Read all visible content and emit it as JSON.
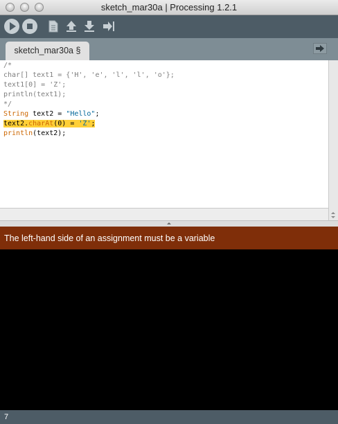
{
  "window": {
    "title": "sketch_mar30a | Processing 1.2.1"
  },
  "toolbar": {
    "buttons": [
      {
        "name": "run",
        "icon": "play-icon"
      },
      {
        "name": "stop",
        "icon": "stop-icon"
      },
      {
        "name": "new",
        "icon": "new-file-icon"
      },
      {
        "name": "open",
        "icon": "open-arrow-up-icon"
      },
      {
        "name": "save",
        "icon": "save-arrow-down-icon"
      },
      {
        "name": "export",
        "icon": "export-arrow-right-icon"
      }
    ]
  },
  "tabs": [
    {
      "label": "sketch_mar30a §"
    }
  ],
  "editor": {
    "lines": [
      "/*",
      "char[] text1 = {'H', 'e', 'l', 'l', 'o'};",
      "text1[0] = 'Z';",
      "println(text1);",
      "*/",
      "String text2 = \"Hello\";",
      "text2.charAt(0) = 'Z';",
      "println(text2);"
    ]
  },
  "status": {
    "message": "The left-hand side of an assignment must be a variable"
  },
  "footer": {
    "line_number": "7"
  },
  "colors": {
    "toolbar_bg": "#4d5c66",
    "tabbar_bg": "#7e8d95",
    "error_bg": "#7f2e09",
    "highlight": "#ffcf37",
    "keyword": "#cc6600",
    "string": "#006699",
    "comment": "#7e7e7e"
  }
}
